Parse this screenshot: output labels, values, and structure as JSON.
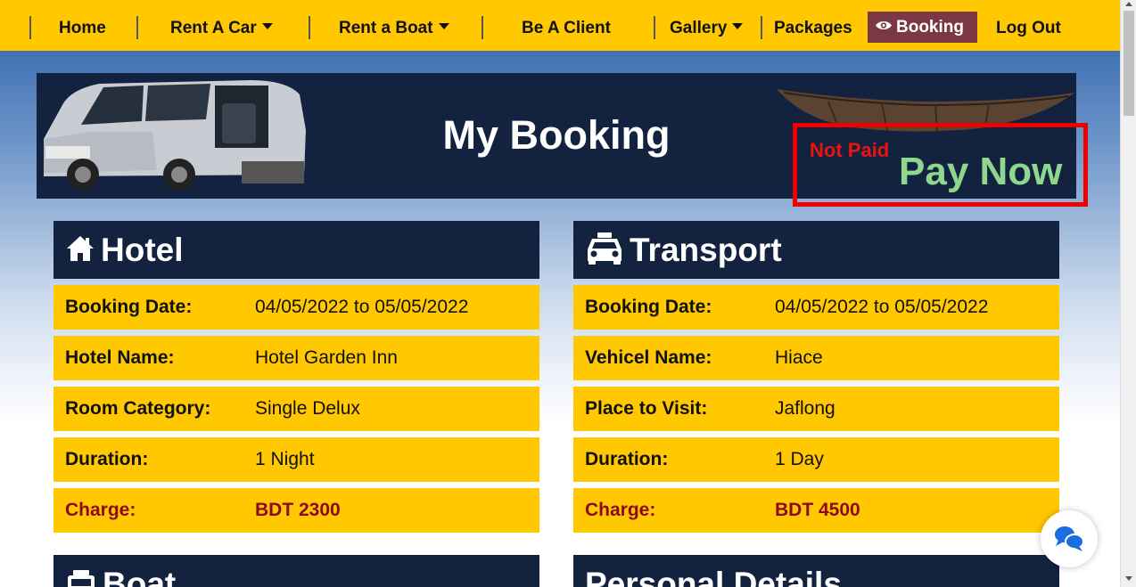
{
  "nav": {
    "home": "Home",
    "rent_car": "Rent A Car",
    "rent_boat": "Rent a Boat",
    "be_client": "Be A Client",
    "gallery": "Gallery",
    "packages": "Packages",
    "booking": "Booking",
    "logout": "Log Out"
  },
  "banner": {
    "title": "My Booking",
    "status": "Not Paid",
    "pay_now": "Pay Now"
  },
  "hotel": {
    "title": "Hotel",
    "rows": [
      {
        "label": "Booking Date:",
        "value": "04/05/2022 to 05/05/2022"
      },
      {
        "label": "Hotel Name:",
        "value": "Hotel Garden Inn"
      },
      {
        "label": "Room Category:",
        "value": "Single Delux"
      },
      {
        "label": "Duration:",
        "value": "1 Night"
      },
      {
        "label": "Charge:",
        "value": "BDT 2300"
      }
    ]
  },
  "transport": {
    "title": "Transport",
    "rows": [
      {
        "label": "Booking Date:",
        "value": "04/05/2022 to 05/05/2022"
      },
      {
        "label": "Vehicel Name:",
        "value": "Hiace"
      },
      {
        "label": "Place to Visit:",
        "value": "Jaflong"
      },
      {
        "label": "Duration:",
        "value": "1 Day"
      },
      {
        "label": "Charge:",
        "value": "BDT 4500"
      }
    ]
  },
  "boat": {
    "title": "Boat"
  },
  "personal": {
    "title": "Personal Details"
  },
  "colors": {
    "nav_bg": "#ffc800",
    "dark_navy": "#13233f",
    "booking_active": "#7b3844",
    "charge_text": "#8b0a1e",
    "pay_now": "#8fd68f",
    "not_paid": "#ee1111"
  }
}
